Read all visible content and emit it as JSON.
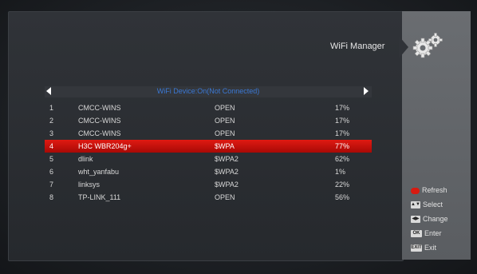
{
  "header": {
    "title": "WiFi Manager",
    "device_status": "WiFi Device:On(Not Connected)"
  },
  "networks": [
    {
      "no": "1",
      "ssid": "CMCC-WINS",
      "security": "OPEN",
      "signal": "17%"
    },
    {
      "no": "2",
      "ssid": "CMCC-WINS",
      "security": "OPEN",
      "signal": "17%"
    },
    {
      "no": "3",
      "ssid": "CMCC-WINS",
      "security": "OPEN",
      "signal": "17%"
    },
    {
      "no": "4",
      "ssid": "H3C WBR204g+",
      "security": "$WPA",
      "signal": "77%"
    },
    {
      "no": "5",
      "ssid": "dlink",
      "security": "$WPA2",
      "signal": "62%"
    },
    {
      "no": "6",
      "ssid": "wht_yanfabu",
      "security": "$WPA2",
      "signal": "1%"
    },
    {
      "no": "7",
      "ssid": "linksys",
      "security": "$WPA2",
      "signal": "22%"
    },
    {
      "no": "8",
      "ssid": "TP-LINK_111",
      "security": "OPEN",
      "signal": "56%"
    }
  ],
  "selected_index": 3,
  "legend": {
    "refresh": "Refresh",
    "select": "Select",
    "change": "Change",
    "ok_key": "OK",
    "enter": "Enter",
    "exit_key": "EXIT",
    "exit": "Exit"
  },
  "icons": {
    "settings": "gear-icon",
    "left": "arrow-left-icon",
    "right": "arrow-right-icon"
  },
  "colors": {
    "highlight": "#d0140c",
    "device_text": "#3b78d4",
    "refresh_key": "#d81a10"
  }
}
